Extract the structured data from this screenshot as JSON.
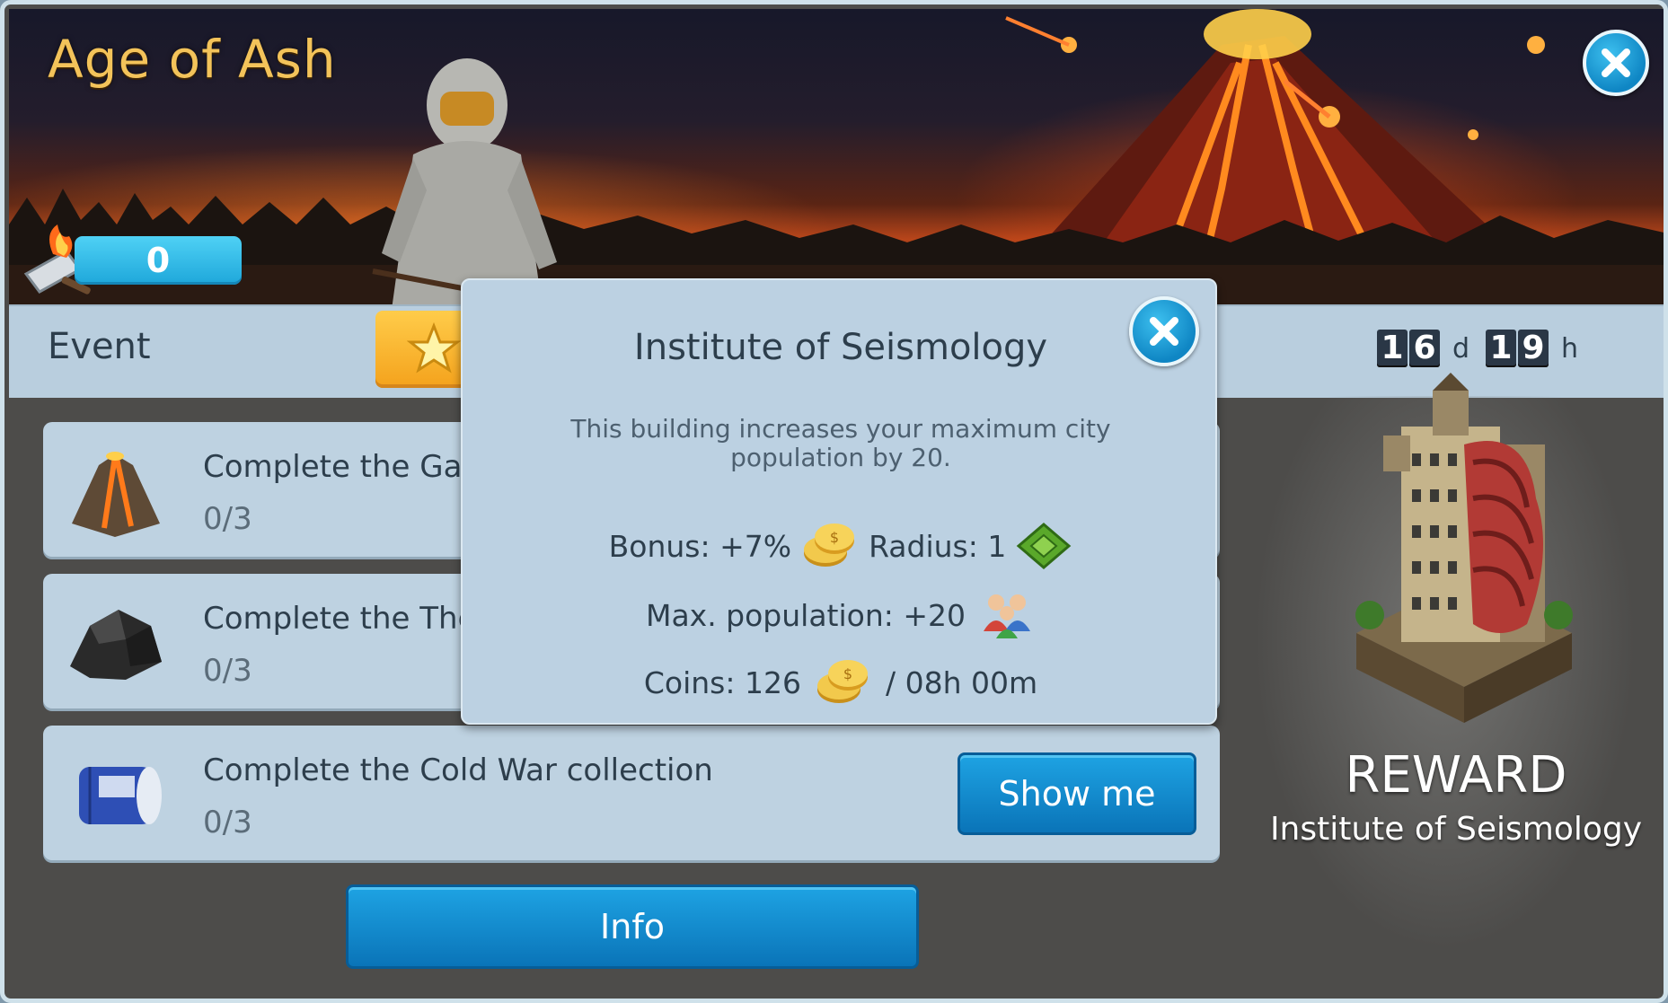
{
  "event": {
    "title": "Age of Ash",
    "score": "0",
    "header_label": "Event",
    "timer": {
      "days": [
        "1",
        "6"
      ],
      "days_unit": "d",
      "hours": [
        "1",
        "9"
      ],
      "hours_unit": "h"
    }
  },
  "tasks": [
    {
      "label": "Complete the Gates",
      "progress": "0/3",
      "icon": "volcano-rock-icon"
    },
    {
      "label": "Complete the They'",
      "progress": "0/3",
      "icon": "black-rock-icon"
    },
    {
      "label": "Complete the Cold War collection",
      "progress": "0/3",
      "icon": "barrel-icon"
    }
  ],
  "buttons": {
    "show_me": "Show me",
    "info": "Info"
  },
  "reward": {
    "title": "REWARD",
    "name": "Institute of Seismology"
  },
  "popup": {
    "title": "Institute of Seismology",
    "description": "This building increases your maximum city population by 20.",
    "bonus_label": "Bonus: +7%",
    "radius_label": "Radius: 1",
    "population_label": "Max. population: +20",
    "coins_label": "Coins: 126",
    "time_label": "/ 08h 00m"
  },
  "colors": {
    "title_gold": "#f3c35a",
    "accent_blue": "#1ea3e3",
    "panel": "#bed2e1"
  }
}
